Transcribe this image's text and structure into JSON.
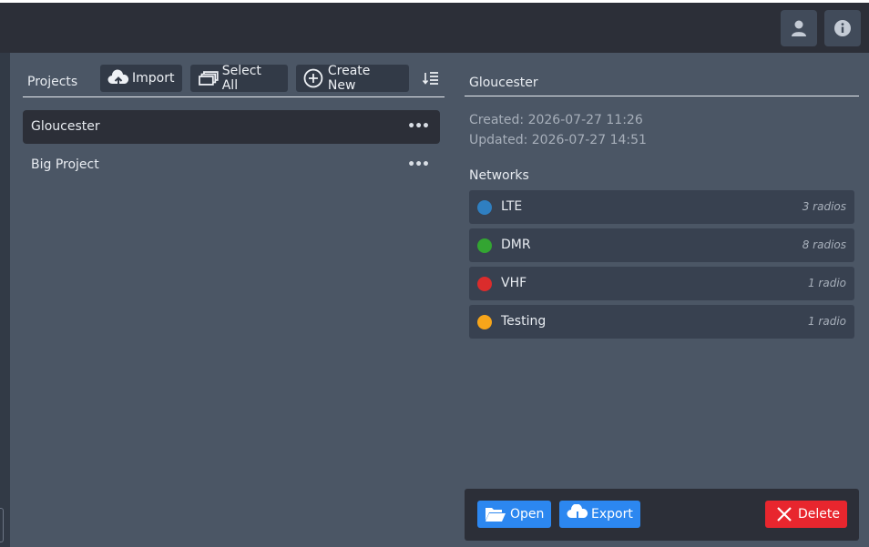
{
  "colors": {
    "topbar": "#2c2f38",
    "panel": "#4b5665",
    "accent_blue": "#2c87f0",
    "danger_red": "#e8262e"
  },
  "header": {
    "user_icon": "user-icon",
    "info_icon": "info-icon"
  },
  "projects": {
    "title": "Projects",
    "toolbar": {
      "import_label": "Import",
      "select_all_label": "Select All",
      "create_new_label": "Create New"
    },
    "items": [
      {
        "name": "Gloucester",
        "selected": true,
        "menu": "•••"
      },
      {
        "name": "Big Project",
        "selected": false,
        "menu": "•••"
      }
    ]
  },
  "detail": {
    "title": "Gloucester",
    "created": "Created: 2026-07-27 11:26",
    "updated": "Updated: 2026-07-27 14:51",
    "networks_heading": "Networks",
    "networks": [
      {
        "name": "LTE",
        "count": "3 radios",
        "color": "#2f7fc1"
      },
      {
        "name": "DMR",
        "count": "8 radios",
        "color": "#33a532"
      },
      {
        "name": "VHF",
        "count": "1 radio",
        "color": "#db2c2c"
      },
      {
        "name": "Testing",
        "count": "1 radio",
        "color": "#f7a51a"
      }
    ]
  },
  "footer": {
    "open_label": "Open",
    "export_label": "Export",
    "delete_label": "Delete"
  }
}
